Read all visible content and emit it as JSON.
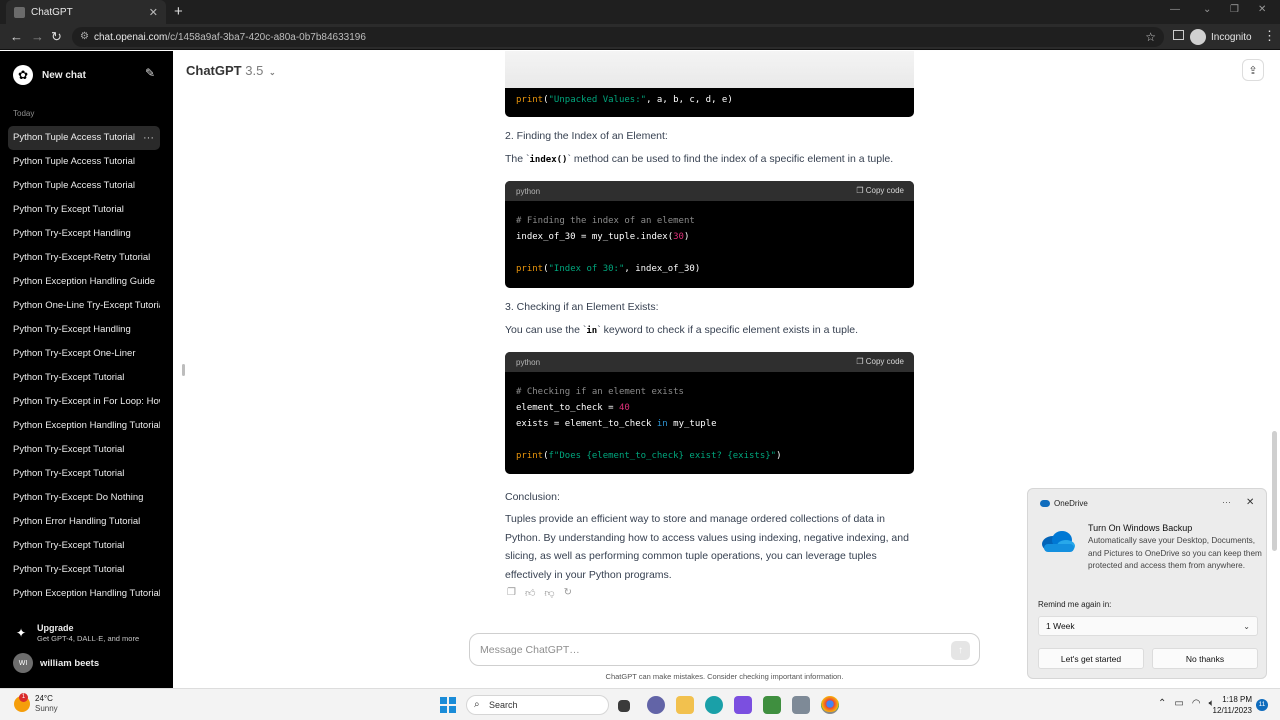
{
  "browser": {
    "tab_title": "ChatGPT",
    "url_host": "chat.openai.com",
    "url_path": "/c/1458a9af-3ba7-420c-a80a-0b7b84633196",
    "profile": "Incognito"
  },
  "sidebar": {
    "new_chat": "New chat",
    "section_label": "Today",
    "conversations": [
      "Python Tuple Access Tutorial",
      "Python Tuple Access Tutorial",
      "Python Tuple Access Tutorial",
      "Python Try Except Tutorial",
      "Python Try-Except Handling",
      "Python Try-Except-Retry Tutorial",
      "Python Exception Handling Guide",
      "Python One-Line Try-Except Tutorial",
      "Python Try-Except Handling",
      "Python Try-Except One-Liner",
      "Python Try-Except Tutorial",
      "Python Try-Except in For Loop: How",
      "Python Exception Handling Tutorial",
      "Python Try-Except Tutorial",
      "Python Try-Except Tutorial",
      "Python Try-Except: Do Nothing",
      "Python Error Handling Tutorial",
      "Python Try-Except Tutorial",
      "Python Try-Except Tutorial",
      "Python Exception Handling Tutorial"
    ],
    "upgrade_title": "Upgrade",
    "upgrade_subtitle": "Get GPT-4, DALL·E, and more",
    "user_initials": "WI",
    "user_name": "william beets"
  },
  "header": {
    "model_name": "ChatGPT",
    "model_version": "3.5"
  },
  "content": {
    "top_code_line": "print(\"Unpacked Values:\", a, b, c, d, e)",
    "section2_heading": "2. Finding the Index of an Element:",
    "section2_pre": "The `",
    "section2_code": "index()",
    "section2_post": "` method can be used to find the index of a specific element in a tuple.",
    "code_lang": "python",
    "copy_label": "Copy code",
    "code2": {
      "line1": "# Finding the index of an element",
      "line2_a": "index_of_30 = my_tuple.index(",
      "line2_num": "30",
      "line2_b": ")",
      "line4_fn": "print",
      "line4_a": "(",
      "line4_str": "\"Index of 30:\"",
      "line4_b": ", index_of_30)"
    },
    "section3_heading": "3. Checking if an Element Exists:",
    "section3_pre": "You can use the `",
    "section3_code": "in",
    "section3_post": "` keyword to check if a specific element exists in a tuple.",
    "code3": {
      "line1": "# Checking if an element exists",
      "line2_a": "element_to_check = ",
      "line2_num": "40",
      "line3_a": "exists = element_to_check ",
      "line3_kw": "in",
      "line3_b": " my_tuple",
      "line5_fn": "print",
      "line5_a": "(",
      "line5_str": "f\"Does {element_to_check} exist? {exists}\"",
      "line5_b": ")"
    },
    "conclusion_heading": "Conclusion:",
    "conclusion_text": "Tuples provide an efficient way to store and manage ordered collections of data in Python. By understanding how to access values using indexing, negative indexing, and slicing, as well as performing common tuple operations, you can leverage tuples effectively in your Python programs."
  },
  "composer": {
    "placeholder": "Message ChatGPT…",
    "disclaimer": "ChatGPT can make mistakes. Consider checking important information."
  },
  "toast": {
    "app_name": "OneDrive",
    "title": "Turn On Windows Backup",
    "body": "Automatically save your Desktop, Documents, and Pictures to OneDrive so you can keep them protected and access them from anywhere.",
    "remind_label": "Remind me again in:",
    "remind_value": "1 Week",
    "primary_button": "Let's get started",
    "secondary_button": "No thanks"
  },
  "taskbar": {
    "temperature": "24°C",
    "weather": "Sunny",
    "weather_badge": "1",
    "search_label": "Search",
    "time": "1:18 PM",
    "date": "12/11/2023",
    "notification_count": "11"
  },
  "colors": {
    "sidebar_bg": "#000000",
    "code_bg": "#000000",
    "code_string": "#00a67d",
    "code_function": "#e9950c",
    "code_number": "#df3079",
    "code_keyword": "#2e95d3",
    "onedrive_blue": "#0f6cbd"
  }
}
